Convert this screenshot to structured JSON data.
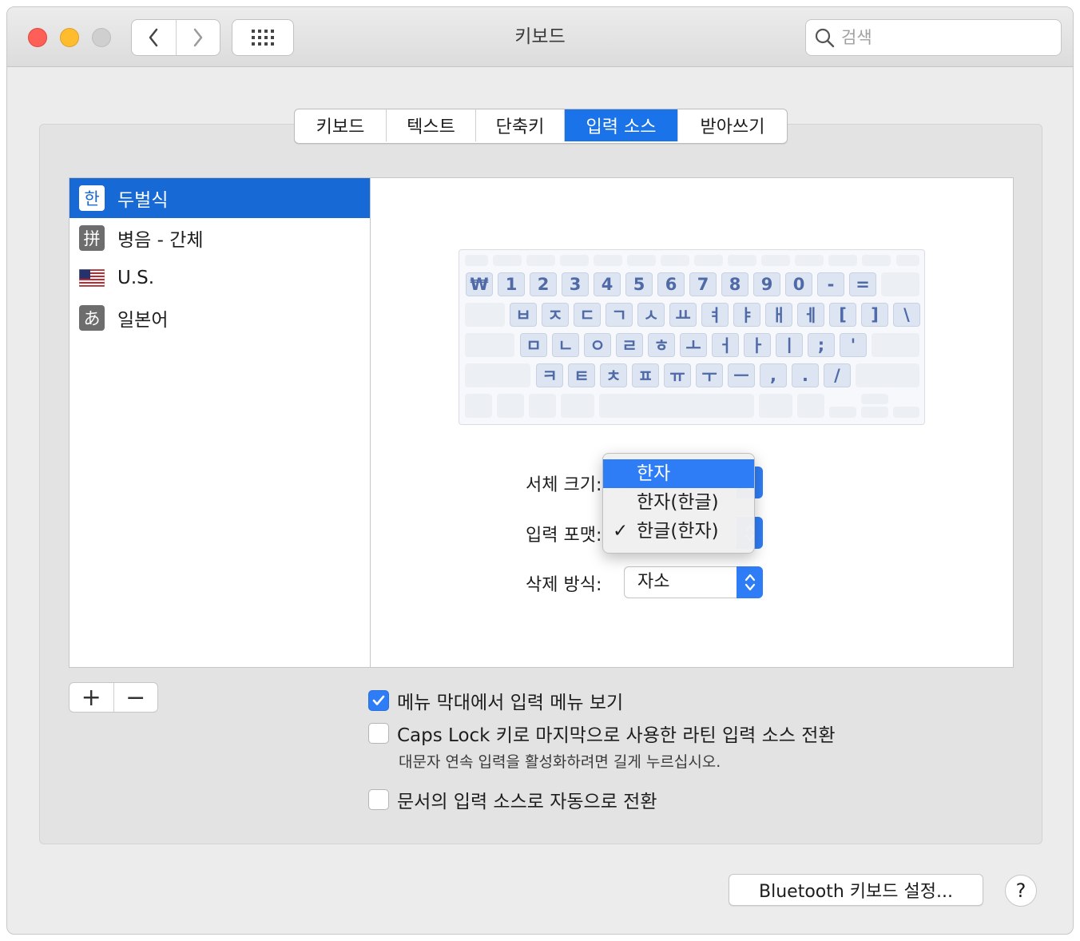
{
  "window": {
    "title": "키보드"
  },
  "search": {
    "placeholder": "검색"
  },
  "tabs": [
    {
      "label": "키보드"
    },
    {
      "label": "텍스트"
    },
    {
      "label": "단축키"
    },
    {
      "label": "입력 소스"
    },
    {
      "label": "받아쓰기"
    }
  ],
  "active_tab": "입력 소스",
  "sources": [
    {
      "icon": "한",
      "label": "두벌식"
    },
    {
      "icon": "拼",
      "label": "병음 - 간체"
    },
    {
      "icon": "us-flag",
      "label": "U.S."
    },
    {
      "icon": "あ",
      "label": "일본어"
    }
  ],
  "keyboard": {
    "row1": [
      "₩",
      "1",
      "2",
      "3",
      "4",
      "5",
      "6",
      "7",
      "8",
      "9",
      "0",
      "-",
      "="
    ],
    "row2": [
      "ㅂ",
      "ㅈ",
      "ㄷ",
      "ㄱ",
      "ㅅ",
      "ㅛ",
      "ㅕ",
      "ㅑ",
      "ㅐ",
      "ㅔ",
      "[",
      "]",
      "\\"
    ],
    "row3": [
      "ㅁ",
      "ㄴ",
      "ㅇ",
      "ㄹ",
      "ㅎ",
      "ㅗ",
      "ㅓ",
      "ㅏ",
      "ㅣ",
      ";",
      "'"
    ],
    "row4": [
      "ㅋ",
      "ㅌ",
      "ㅊ",
      "ㅍ",
      "ㅠ",
      "ㅜ",
      "ㅡ",
      ",",
      ".",
      "/"
    ]
  },
  "settings": {
    "font_size_label": "서체 크기:",
    "input_format_label": "입력 포맷:",
    "delete_method_label": "삭제 방식:",
    "delete_method_value": "자소"
  },
  "format_menu": {
    "options": [
      "한자",
      "한자(한글)",
      "한글(한자)"
    ],
    "highlighted": "한자",
    "checked": "한글(한자)",
    "check_mark": "✓"
  },
  "list_buttons": {
    "add": "+",
    "remove": "−"
  },
  "checkboxes": [
    {
      "label": "메뉴 막대에서 입력 메뉴 보기",
      "checked": true
    },
    {
      "label": "Caps Lock 키로 마지막으로 사용한 라틴 입력 소스 전환",
      "checked": false,
      "note": "대문자 연속 입력을 활성화하려면 길게 누르십시오."
    },
    {
      "label": "문서의 입력 소스로 자동으로 전환",
      "checked": false
    }
  ],
  "footer": {
    "bluetooth_button": "Bluetooth 키보드 설정...",
    "help_button": "?"
  },
  "colors": {
    "accent": "#1769d6",
    "menu_highlight": "#2e7cf6",
    "key_text": "#4f6aa7"
  }
}
